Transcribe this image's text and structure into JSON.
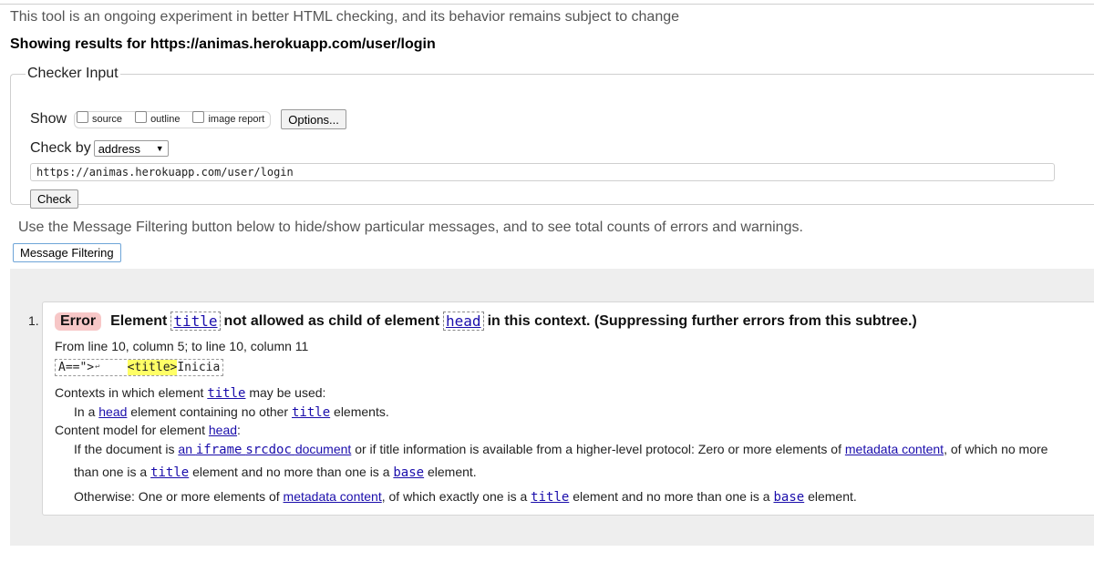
{
  "header": {
    "experiment_note": "This tool is an ongoing experiment in better HTML checking, and its behavior remains subject to change",
    "showing_results": "Showing results for https://animas.herokuapp.com/user/login"
  },
  "checker_input": {
    "legend": "Checker Input",
    "show_label": "Show",
    "options": [
      {
        "label": "source",
        "checked": false
      },
      {
        "label": "outline",
        "checked": false
      },
      {
        "label": "image report",
        "checked": false
      }
    ],
    "options_button": "Options...",
    "check_by_label": "Check by",
    "check_by_value": "address",
    "url_value": "https://animas.herokuapp.com/user/login",
    "check_button": "Check"
  },
  "filtering": {
    "note": "Use the Message Filtering button below to hide/show particular messages, and to see total counts of errors and warnings.",
    "button": "Message Filtering"
  },
  "messages": [
    {
      "number": "1.",
      "type": "Error",
      "text_1": "Element",
      "code_1": "title",
      "text_2": "not allowed as child of element",
      "code_2": "head",
      "text_3": "in this context. (Suppressing further errors from this subtree.)",
      "location": "From line 10, column 5; to line 10, column 11",
      "extract_pre": "A==\">",
      "extract_return": "↩",
      "extract_highlight": "<title>",
      "extract_post": "Inicia",
      "contexts_pre": "Contexts in which element",
      "contexts_code": "title",
      "contexts_post": "may be used:",
      "context_item_1": "In a",
      "context_item_link": "head",
      "context_item_2": "element containing no other",
      "context_item_code": "title",
      "context_item_3": "elements.",
      "content_model_pre": "Content model for element",
      "content_model_link": "head",
      "content_model_post": ":",
      "cm1_a": "If the document is",
      "cm1_link1_a": "an",
      "cm1_link1_code": "iframe",
      "cm1_link1_code2": "srcdoc",
      "cm1_link1_b": "document",
      "cm1_b": "or if title information is available from a higher-level protocol: Zero or more elements of",
      "cm1_link2": "metadata content",
      "cm1_c": ", of which no more",
      "cm1_d": "than one is a",
      "cm1_code1": "title",
      "cm1_e": "element and no more than one is a",
      "cm1_code2": "base",
      "cm1_f": "element.",
      "cm2_a": "Otherwise: One or more elements of",
      "cm2_link": "metadata content",
      "cm2_b": ", of which exactly one is a",
      "cm2_code1": "title",
      "cm2_c": "element and no more than one is a",
      "cm2_code2": "base",
      "cm2_d": "element."
    }
  ]
}
